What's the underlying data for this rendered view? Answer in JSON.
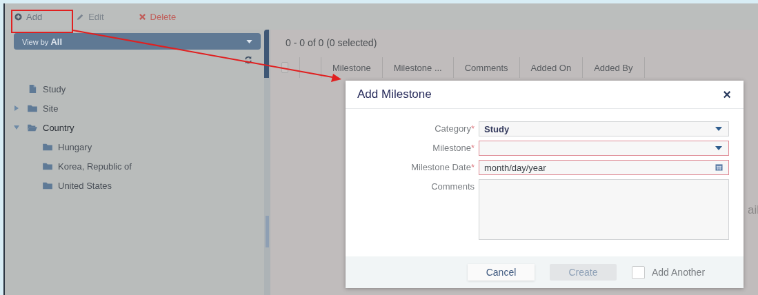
{
  "toolbar": [
    {
      "kind": "add",
      "label": "Add"
    },
    {
      "kind": "edit",
      "label": "Edit"
    },
    {
      "kind": "delete",
      "label": "Delete"
    }
  ],
  "view_by": {
    "prefix": "View by",
    "value": "All"
  },
  "tree": [
    {
      "kind": "file",
      "label": "Study"
    },
    {
      "kind": "folder",
      "label": "Site",
      "expanded": false
    },
    {
      "kind": "folder",
      "label": "Country",
      "expanded": true,
      "children": [
        {
          "kind": "folder",
          "label": "Hungary"
        },
        {
          "kind": "folder",
          "label": "Korea, Republic of"
        },
        {
          "kind": "folder",
          "label": "United States"
        }
      ]
    }
  ],
  "grid": {
    "summary": "0 - 0 of 0 (0 selected)",
    "select_all_checked": false,
    "columns": [
      "Milestone",
      "Milestone ...",
      "Comments",
      "Added On",
      "Added By"
    ],
    "empty_message": "ail"
  },
  "dialog": {
    "title": "Add Milestone",
    "close": "×",
    "fields": [
      {
        "kind": "select",
        "label": "Category",
        "required": true,
        "value": "Study",
        "invalid": false
      },
      {
        "kind": "select",
        "label": "Milestone",
        "required": true,
        "invalid": true
      },
      {
        "kind": "date",
        "label": "Milestone Date",
        "required": true,
        "placeholder": "month/day/year",
        "invalid": true
      },
      {
        "kind": "textarea",
        "label": "Comments",
        "required": false,
        "invalid": false
      }
    ],
    "buttons": [
      {
        "kind": "cancel",
        "label": "Cancel",
        "disabled": false
      },
      {
        "kind": "create",
        "label": "Create",
        "disabled": true
      }
    ],
    "add_another": {
      "label": "Add Another",
      "checked": false
    }
  },
  "required_mark": "*"
}
